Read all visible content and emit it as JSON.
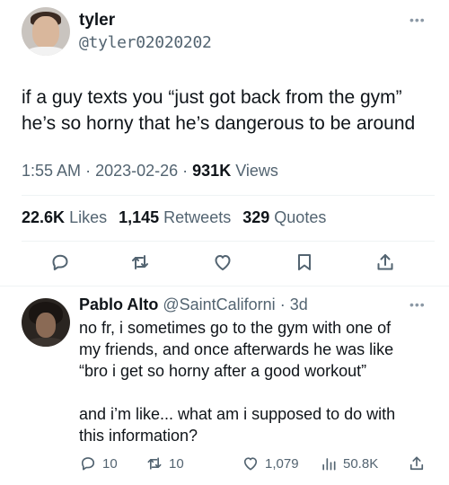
{
  "tweet": {
    "author_name": "tyler",
    "author_handle": "@tyler02020202",
    "more_icon": "ellipsis-icon",
    "text_line1": "if a guy texts you “just got back from the gym”",
    "text_line2": "he’s so horny that he’s dangerous to be around",
    "time": "1:55 AM",
    "date": "2023-02-26",
    "views_count": "931K",
    "views_label": "Views",
    "likes_count": "22.6K",
    "likes_label": "Likes",
    "retweets_count": "1,145",
    "retweets_label": "Retweets",
    "quotes_count": "329",
    "quotes_label": "Quotes",
    "actions": [
      "reply-icon",
      "retweet-icon",
      "like-icon",
      "bookmark-icon",
      "share-icon"
    ]
  },
  "reply": {
    "author_name": "Pablo Alto",
    "author_handle": "@SaintCaliforni",
    "time": "3d",
    "line1": "no fr, i sometimes go to the gym with one of",
    "line2": "my friends, and once afterwards he was like",
    "line3": "“bro i get so horny after a good workout”",
    "line4": "and i’m like... what am i supposed to do with",
    "line5": "this information?",
    "reply_count": "10",
    "retweet_count": "10",
    "like_count": "1,079",
    "views_count": "50.8K"
  },
  "colors": {
    "text": "#0f1419",
    "secondary": "#536471",
    "divider": "#eff3f4"
  }
}
